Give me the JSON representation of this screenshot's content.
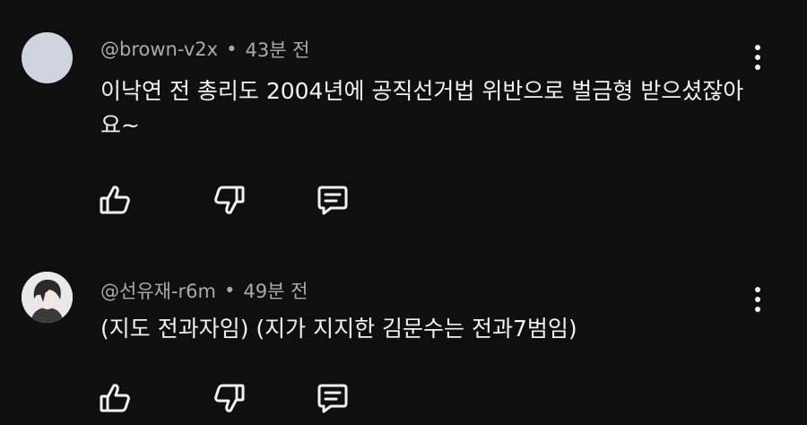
{
  "comments": [
    {
      "handle": "@brown-v2x",
      "separator": "•",
      "time": "43분 전",
      "text": "이낙연 전 총리도 2004년에 공직선거법 위반으로 벌금형 받으셨잖아요~",
      "avatar_color": "#cfd4e0",
      "actions": {
        "like_icon": "thumbs-up-icon",
        "dislike_icon": "thumbs-down-icon",
        "reply_icon": "reply-icon"
      },
      "more_icon": "more-vert-icon"
    },
    {
      "handle": "@선유재-r6m",
      "separator": "•",
      "time": "49분 전",
      "text": "(지도 전과자임) (지가 지지한 김문수는 전과7범임)",
      "avatar_color": "#e6e6e6",
      "actions": {
        "like_icon": "thumbs-up-icon",
        "dislike_icon": "thumbs-down-icon",
        "reply_icon": "reply-icon"
      },
      "more_icon": "more-vert-icon"
    }
  ],
  "colors": {
    "background": "#0f0f0f",
    "text": "#f1f1f1",
    "meta": "#aaaaaa"
  }
}
